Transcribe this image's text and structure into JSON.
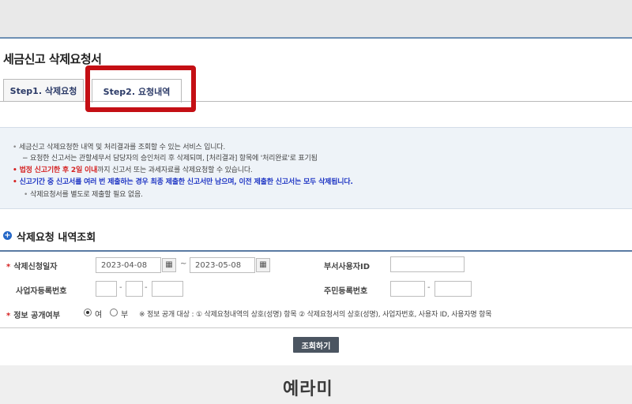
{
  "page": {
    "title": "세금신고 삭제요청서"
  },
  "tabs": [
    {
      "label": "Step1. 삭제요청"
    },
    {
      "label": "Step2. 요청내역"
    }
  ],
  "info": {
    "line1": "세금신고 삭제요청한 내역 및 처리결과를 조회할 수 있는 서비스 입니다.",
    "line2": "− 요청한 신고서는 관할세무서 담당자의 승인처리 후 삭제되며, [처리결과] 항목에 '처리완료'로 표기됨",
    "line3_red": "법정 신고기한 후 2일 이내",
    "line3_rest": "까지 신고서 또는 과세자료를 삭제요청할 수 있습니다.",
    "line4": "신고기간 중 신고서를 여러 번 제출하는 경우 최종 제출한 신고서만 남으며, 이전 제출한 신고서는 모두 삭제됩니다.",
    "line5": "삭제요청서를 별도로 제출할 필요 없음."
  },
  "section": {
    "title": "삭제요청 내역조회"
  },
  "form": {
    "request_date_label": "삭제신청일자",
    "date_from": "2023-04-08",
    "date_to": "2023-05-08",
    "tilde": "~",
    "dept_user_label": "부서사용자ID",
    "biz_no_label": "사업자등록번호",
    "resident_no_label": "주민등록번호",
    "dash": "-",
    "disclosure_label": "정보 공개여부",
    "yes": "여",
    "no": "부",
    "disclosure_notice": "※ 정보 공개 대상 : ① 삭제요청내역의 상호(성명) 항목  ② 삭제요청서의 상호(성명), 사업자번호, 사용자 ID, 사용자명 항목"
  },
  "buttons": {
    "search": "조회하기"
  },
  "watermark": "예라미"
}
